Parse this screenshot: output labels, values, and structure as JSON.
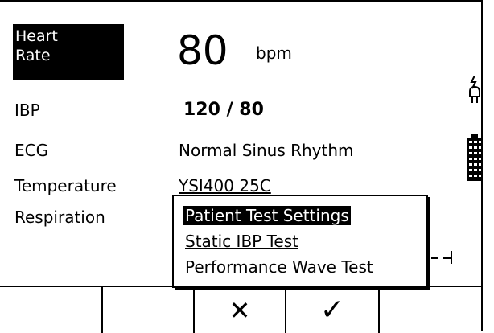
{
  "heart_rate": {
    "label_line1": "Heart",
    "label_line2": "Rate",
    "value": "80",
    "unit": "bpm"
  },
  "rows": [
    {
      "label": "IBP",
      "value": "120 / 80"
    },
    {
      "label": "ECG",
      "value": "Normal Sinus Rhythm"
    },
    {
      "label": "Temperature",
      "value": "YSI400 25C"
    },
    {
      "label": "Respiration",
      "value": ""
    }
  ],
  "menu": {
    "items": [
      {
        "label": "Patient Test Settings",
        "selected": true
      },
      {
        "label": "Static IBP Test",
        "selected": false
      },
      {
        "label": "Performance Wave Test",
        "selected": false
      }
    ]
  },
  "softkeys": {
    "cancel_glyph": "✕",
    "ok_glyph": "✓"
  },
  "icons": {
    "power": "plug-icon",
    "battery": "battery-icon"
  }
}
